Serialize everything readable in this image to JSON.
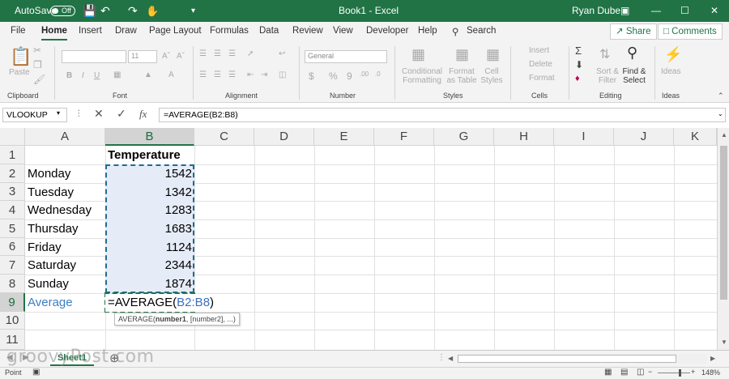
{
  "titlebar": {
    "autosave": "AutoSave",
    "toggle": "Off",
    "doc_title": "Book1 - Excel",
    "user": "Ryan Dube"
  },
  "tabs": [
    "File",
    "Home",
    "Insert",
    "Draw",
    "Page Layout",
    "Formulas",
    "Data",
    "Review",
    "View",
    "Developer",
    "Help"
  ],
  "search_label": "Search",
  "share_label": "Share",
  "comments_label": "Comments",
  "ribbon": {
    "paste": "Paste",
    "font_size": "11",
    "number_format": "General",
    "groups": [
      "Clipboard",
      "Font",
      "Alignment",
      "Number",
      "Styles",
      "Cells",
      "Editing",
      "Ideas"
    ],
    "styles": [
      "Conditional Formatting",
      "Format as Table",
      "Cell Styles"
    ],
    "cells": [
      "Insert",
      "Delete",
      "Format"
    ],
    "editing": [
      "Sort & Filter",
      "Find & Select"
    ],
    "ideas": "Ideas"
  },
  "formula_bar": {
    "name_box": "VLOOKUP",
    "formula": "=AVERAGE(B2:B8)"
  },
  "columns": [
    "A",
    "B",
    "C",
    "D",
    "E",
    "F",
    "G",
    "H",
    "I",
    "J",
    "K"
  ],
  "rows": [
    "1",
    "2",
    "3",
    "4",
    "5",
    "6",
    "7",
    "8",
    "9",
    "10",
    "11"
  ],
  "cells": {
    "b1": "Temperature",
    "a": [
      "Monday",
      "Tuesday",
      "Wednesday",
      "Thursday",
      "Friday",
      "Saturday",
      "Sunday"
    ],
    "b": [
      "1542",
      "1342",
      "1283",
      "1683",
      "1124",
      "2344",
      "1874"
    ],
    "a9": "Average",
    "b9_prefix": "=AVERAGE(",
    "b9_ref": "B2:B8",
    "b9_suffix": ")"
  },
  "tooltip": {
    "fn": "AVERAGE(",
    "arg1": "number1",
    "rest": ", [number2], ...)"
  },
  "sheet_tab": "Sheet1",
  "status": {
    "mode": "Point",
    "zoom": "148%"
  },
  "watermark": "groovyPost.com"
}
